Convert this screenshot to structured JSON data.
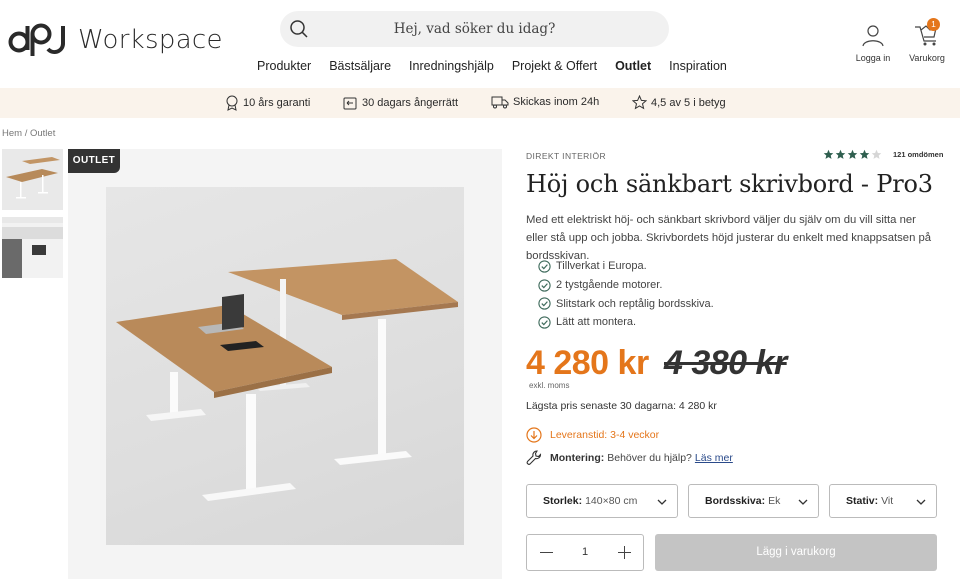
{
  "header": {
    "logo_text": "Workspace",
    "search_placeholder": "Hej, vad söker du idag?",
    "nav": [
      "Produkter",
      "Bästsäljare",
      "Inredningshjälp",
      "Projekt & Offert",
      "Outlet",
      "Inspiration"
    ],
    "active_nav": "Outlet",
    "login_label": "Logga in",
    "cart_label": "Varukorg",
    "cart_count": "1"
  },
  "usp": [
    {
      "icon": "award-icon",
      "text": "10 års garanti"
    },
    {
      "icon": "return-icon",
      "text": "30 dagars ångerrätt"
    },
    {
      "icon": "truck-icon",
      "text": "Skickas inom 24h"
    },
    {
      "icon": "star-outline-icon",
      "text": "4,5 av 5 i betyg"
    }
  ],
  "breadcrumb": {
    "home": "Hem",
    "separator": "/",
    "current": "Outlet"
  },
  "gallery": {
    "badge": "OUTLET"
  },
  "product": {
    "brand": "DIREKT INTERIÖR",
    "rating_stars": 4,
    "review_count": "121 omdömen",
    "title": "Höj och sänkbart skrivbord - Pro3",
    "description": "Med ett elektriskt höj- och sänkbart skrivbord väljer du själv om du vill sitta ner eller stå upp och jobba. Skrivbordets höjd justerar du enkelt med knappsatsen på bordsskivan.",
    "features": [
      "Tillverkat i Europa.",
      "2 tystgående motorer.",
      "Slitstark och reptålig bordsskiva.",
      "Lätt att montera."
    ],
    "price": "4 280 kr",
    "old_price": "4 380 kr",
    "vat_note": "exkl. moms",
    "lowest_price": "Lägsta pris senaste 30 dagarna: 4 280 kr",
    "delivery": "Leveranstid: 3-4 veckor",
    "assembly_label": "Montering:",
    "assembly_text": "Behöver du hjälp?",
    "assembly_link": "Läs mer",
    "options": [
      {
        "label": "Storlek:",
        "value": "140×80 cm"
      },
      {
        "label": "Bordsskiva:",
        "value": "Ek"
      },
      {
        "label": "Stativ:",
        "value": "Vit"
      }
    ],
    "quantity": "1",
    "add_to_cart": "Lägg i varukorg"
  },
  "colors": {
    "accent": "#e4761b",
    "usp_bg": "#faf3eb",
    "button_disabled": "#c4c4c4",
    "star": "#2f5f4f"
  }
}
